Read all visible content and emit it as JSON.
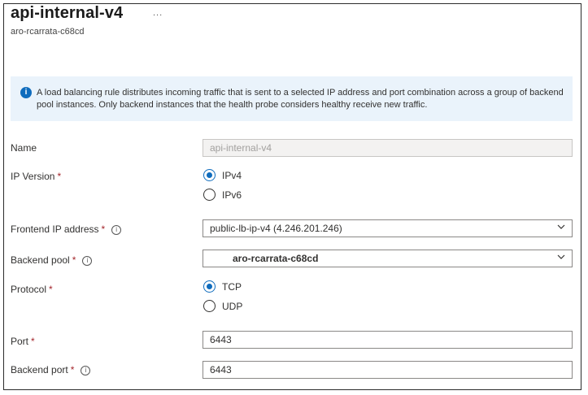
{
  "header": {
    "title": "api-internal-v4",
    "more": "...",
    "subtitle": "aro-rcarrata-c68cd"
  },
  "info": {
    "text": "A load balancing rule distributes incoming traffic that is sent to a selected IP address and port combination across a group of backend pool instances. Only backend instances that the health probe considers healthy receive new traffic.",
    "icon": "info-icon"
  },
  "form": {
    "name": {
      "label": "Name",
      "value": "api-internal-v4"
    },
    "ip_version": {
      "label": "IP Version",
      "required": "*",
      "options": [
        {
          "label": "IPv4",
          "selected": true
        },
        {
          "label": "IPv6",
          "selected": false
        }
      ]
    },
    "frontend_ip": {
      "label": "Frontend IP address",
      "required": "*",
      "info": "i",
      "value": "public-lb-ip-v4 (4.246.201.246)"
    },
    "backend_pool": {
      "label": "Backend pool",
      "required": "*",
      "info": "i",
      "value": "aro-rcarrata-c68cd"
    },
    "protocol": {
      "label": "Protocol",
      "required": "*",
      "options": [
        {
          "label": "TCP",
          "selected": true
        },
        {
          "label": "UDP",
          "selected": false
        }
      ]
    },
    "port": {
      "label": "Port",
      "required": "*",
      "value": "6443"
    },
    "backend_port": {
      "label": "Backend port",
      "required": "*",
      "info": "i",
      "value": "6443"
    }
  },
  "colors": {
    "accent": "#0f6cbd",
    "required": "#a4262c",
    "info_bg": "#eaf3fb"
  }
}
